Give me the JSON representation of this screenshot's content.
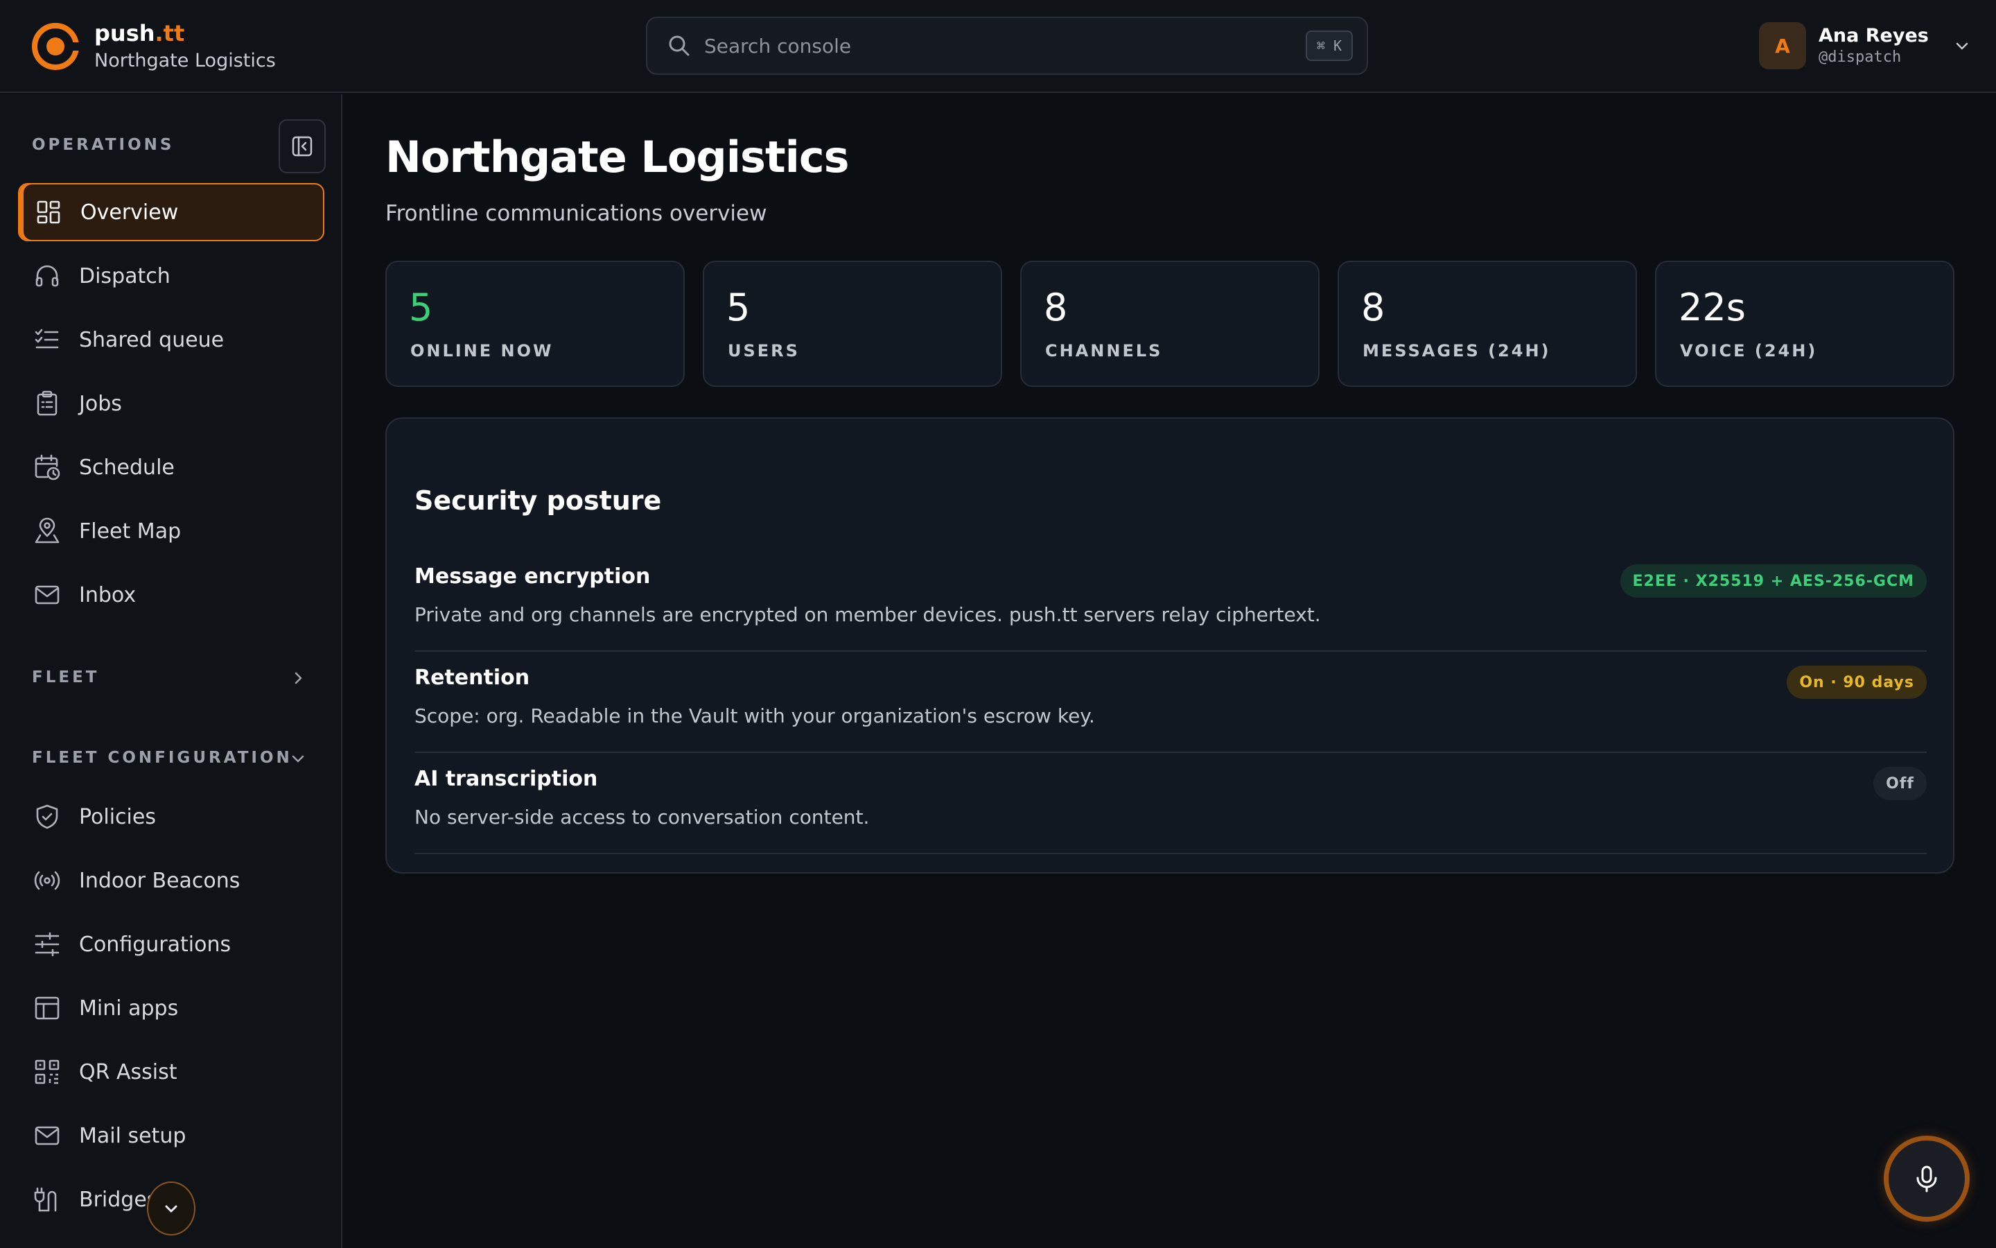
{
  "brand": {
    "name_prefix": "push",
    "name_suffix": ".tt",
    "org": "Northgate Logistics",
    "accent_color": "#f07a14"
  },
  "search": {
    "placeholder": "Search console",
    "shortcut": "⌘ K"
  },
  "user": {
    "initial": "A",
    "name": "Ana Reyes",
    "handle": "@dispatch"
  },
  "sidebar": {
    "operations_label": "OPERATIONS",
    "operations": [
      {
        "label": "Overview",
        "icon": "grid-icon",
        "active": true
      },
      {
        "label": "Dispatch",
        "icon": "headset-icon"
      },
      {
        "label": "Shared queue",
        "icon": "checklist-icon"
      },
      {
        "label": "Jobs",
        "icon": "clipboard-icon"
      },
      {
        "label": "Schedule",
        "icon": "calendar-clock-icon"
      },
      {
        "label": "Fleet Map",
        "icon": "map-pin-person-icon"
      },
      {
        "label": "Inbox",
        "icon": "mail-icon"
      }
    ],
    "fleet_label": "FLEET",
    "fleet_config_label": "FLEET CONFIGURATION",
    "fleet_config": [
      {
        "label": "Policies",
        "icon": "shield-check-icon"
      },
      {
        "label": "Indoor Beacons",
        "icon": "broadcast-icon"
      },
      {
        "label": "Configurations",
        "icon": "sliders-icon"
      },
      {
        "label": "Mini apps",
        "icon": "layout-icon"
      },
      {
        "label": "QR Assist",
        "icon": "qr-code-icon"
      },
      {
        "label": "Mail setup",
        "icon": "mail-icon"
      },
      {
        "label": "Bridges",
        "icon": "plug-icon"
      }
    ]
  },
  "main": {
    "title": "Northgate Logistics",
    "subtitle": "Frontline communications overview",
    "stats": [
      {
        "value": "5",
        "caption": "ONLINE NOW",
        "highlight": "#3ecf7a"
      },
      {
        "value": "5",
        "caption": "USERS"
      },
      {
        "value": "8",
        "caption": "CHANNELS"
      },
      {
        "value": "8",
        "caption": "MESSAGES (24H)"
      },
      {
        "value": "22s",
        "caption": "VOICE (24H)"
      }
    ],
    "security": {
      "title": "Security posture",
      "rows": [
        {
          "title": "Message encryption",
          "description": "Private and org channels are encrypted on member devices. push.tt servers relay ciphertext.",
          "badge": "E2EE · X25519 + AES-256-GCM",
          "badge_color": "#3ecf7a"
        },
        {
          "title": "Retention",
          "description": "Scope: org. Readable in the Vault with your organization's escrow key.",
          "badge": "On · 90 days",
          "badge_color": "#e9b824"
        },
        {
          "title": "AI transcription",
          "description": "No server-side access to conversation content.",
          "badge": "Off",
          "badge_color": "#b9bec6"
        }
      ]
    }
  }
}
